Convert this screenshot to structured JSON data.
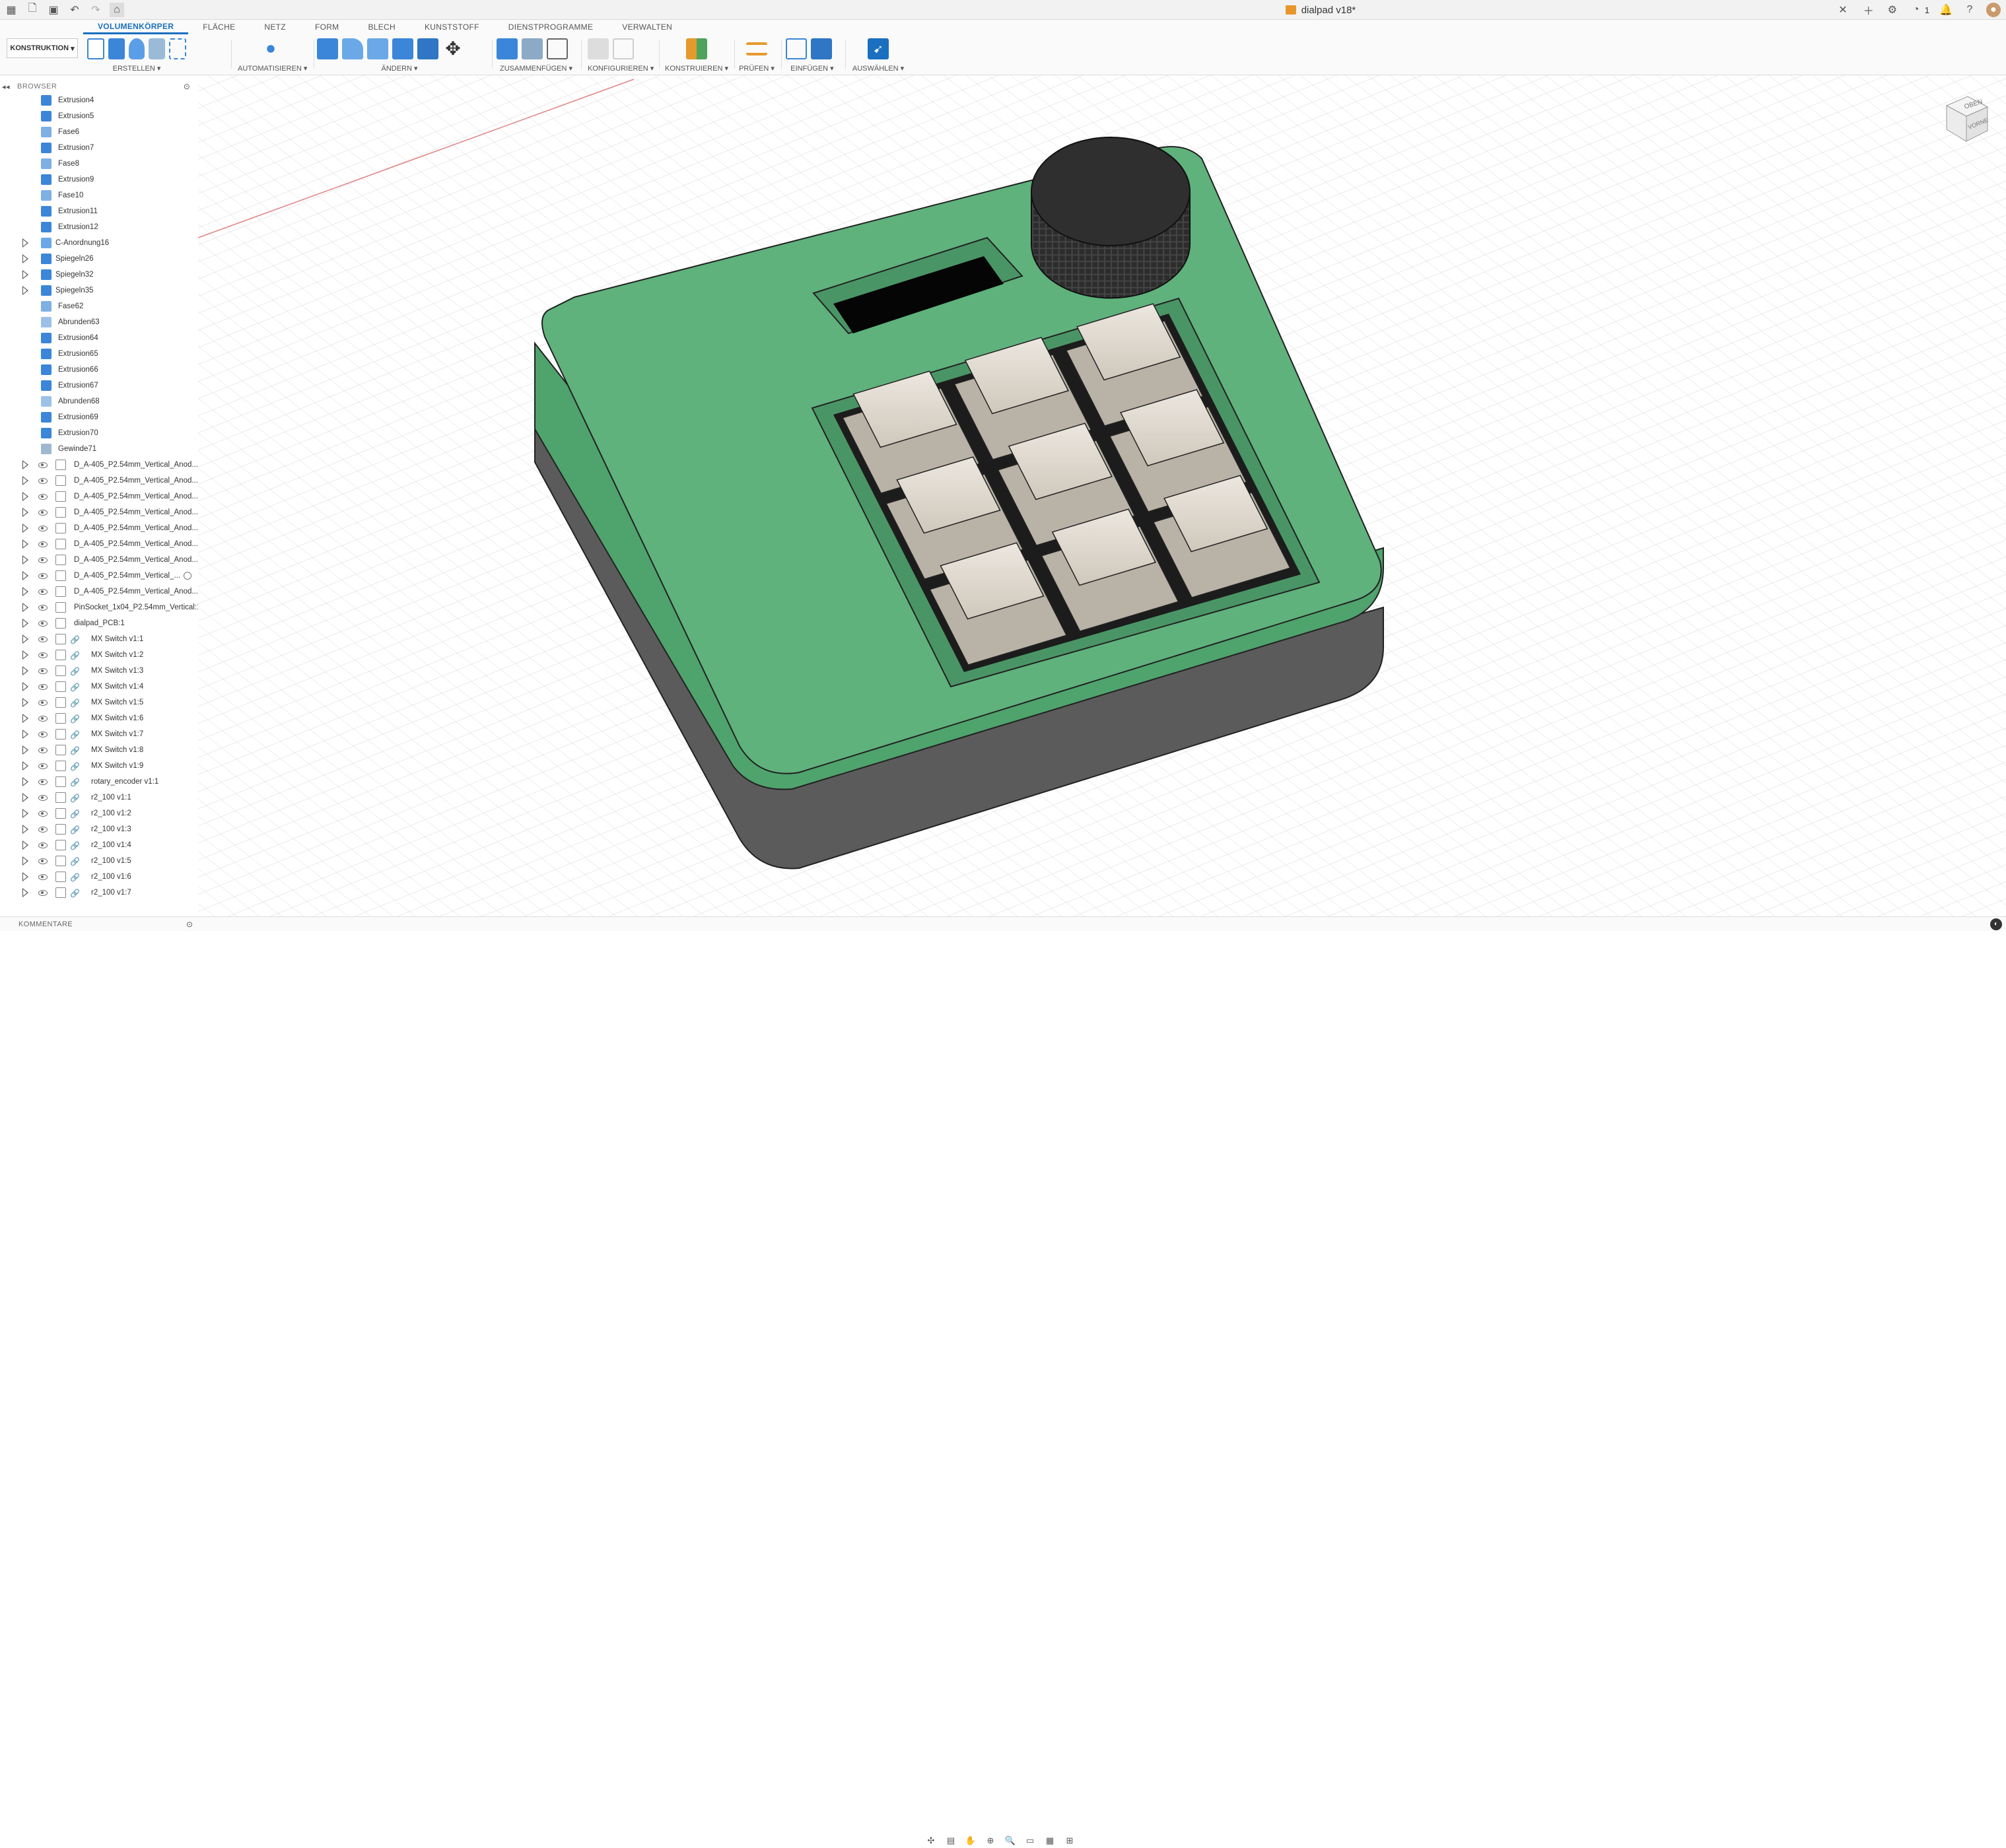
{
  "titlebar": {
    "doc_title": "dialpad v18*",
    "notif_count": "1"
  },
  "ribbon": {
    "workspace_label": "KONSTRUKTION",
    "tabs": [
      {
        "label": "VOLUMENKÖRPER",
        "active": true
      },
      {
        "label": "FLÄCHE",
        "active": false
      },
      {
        "label": "NETZ",
        "active": false
      },
      {
        "label": "FORM",
        "active": false
      },
      {
        "label": "BLECH",
        "active": false
      },
      {
        "label": "KUNSTSTOFF",
        "active": false
      },
      {
        "label": "DIENSTPROGRAMME",
        "active": false
      },
      {
        "label": "VERWALTEN",
        "active": false
      }
    ],
    "groups": {
      "erstellen": "ERSTELLEN ▾",
      "automatisieren": "AUTOMATISIEREN ▾",
      "aendern": "ÄNDERN ▾",
      "zusammenfuegen": "ZUSAMMENFÜGEN ▾",
      "konfigurieren": "KONFIGURIEREN ▾",
      "konstruieren": "KONSTRUIEREN ▾",
      "pruefen": "PRÜFEN ▾",
      "einfuegen": "EINFÜGEN ▾",
      "auswaehlen": "AUSWÄHLEN ▾"
    }
  },
  "browser": {
    "header": "BROWSER",
    "features": [
      {
        "label": "Extrusion4",
        "kind": "extrude"
      },
      {
        "label": "Extrusion5",
        "kind": "extrude"
      },
      {
        "label": "Fase6",
        "kind": "chamfer"
      },
      {
        "label": "Extrusion7",
        "kind": "extrude"
      },
      {
        "label": "Fase8",
        "kind": "chamfer"
      },
      {
        "label": "Extrusion9",
        "kind": "extrude"
      },
      {
        "label": "Fase10",
        "kind": "chamfer"
      },
      {
        "label": "Extrusion11",
        "kind": "extrude"
      },
      {
        "label": "Extrusion12",
        "kind": "extrude"
      },
      {
        "label": "C-Anordnung16",
        "kind": "pattern",
        "expandable": true
      },
      {
        "label": "Spiegeln26",
        "kind": "mirror",
        "expandable": true
      },
      {
        "label": "Spiegeln32",
        "kind": "mirror",
        "expandable": true
      },
      {
        "label": "Spiegeln35",
        "kind": "mirror",
        "expandable": true
      },
      {
        "label": "Fase62",
        "kind": "chamfer"
      },
      {
        "label": "Abrunden63",
        "kind": "fillet"
      },
      {
        "label": "Extrusion64",
        "kind": "extrude"
      },
      {
        "label": "Extrusion65",
        "kind": "extrude"
      },
      {
        "label": "Extrusion66",
        "kind": "extrude"
      },
      {
        "label": "Extrusion67",
        "kind": "extrude"
      },
      {
        "label": "Abrunden68",
        "kind": "fillet"
      },
      {
        "label": "Extrusion69",
        "kind": "extrude"
      },
      {
        "label": "Extrusion70",
        "kind": "extrude"
      },
      {
        "label": "Gewinde71",
        "kind": "thread"
      }
    ],
    "components": [
      {
        "label": "D_A-405_P2.54mm_Vertical_Anod...",
        "link": false
      },
      {
        "label": "D_A-405_P2.54mm_Vertical_Anod...",
        "link": false
      },
      {
        "label": "D_A-405_P2.54mm_Vertical_Anod...",
        "link": false
      },
      {
        "label": "D_A-405_P2.54mm_Vertical_Anod...",
        "link": false
      },
      {
        "label": "D_A-405_P2.54mm_Vertical_Anod...",
        "link": false
      },
      {
        "label": "D_A-405_P2.54mm_Vertical_Anod...",
        "link": false
      },
      {
        "label": "D_A-405_P2.54mm_Vertical_Anod...",
        "link": false
      },
      {
        "label": "D_A-405_P2.54mm_Vertical_...",
        "link": false,
        "radio": true
      },
      {
        "label": "D_A-405_P2.54mm_Vertical_Anod...",
        "link": false
      },
      {
        "label": "PinSocket_1x04_P2.54mm_Vertical:1",
        "link": false
      },
      {
        "label": "dialpad_PCB:1",
        "link": false
      },
      {
        "label": "MX Switch v1:1",
        "link": true
      },
      {
        "label": "MX Switch v1:2",
        "link": true
      },
      {
        "label": "MX Switch v1:3",
        "link": true
      },
      {
        "label": "MX Switch v1:4",
        "link": true
      },
      {
        "label": "MX Switch v1:5",
        "link": true
      },
      {
        "label": "MX Switch v1:6",
        "link": true
      },
      {
        "label": "MX Switch v1:7",
        "link": true
      },
      {
        "label": "MX Switch v1:8",
        "link": true
      },
      {
        "label": "MX Switch v1:9",
        "link": true
      },
      {
        "label": "rotary_encoder v1:1",
        "link": true
      },
      {
        "label": "r2_100 v1:1",
        "link": true
      },
      {
        "label": "r2_100 v1:2",
        "link": true
      },
      {
        "label": "r2_100 v1:3",
        "link": true
      },
      {
        "label": "r2_100 v1:4",
        "link": true
      },
      {
        "label": "r2_100 v1:5",
        "link": true
      },
      {
        "label": "r2_100 v1:6",
        "link": true
      },
      {
        "label": "r2_100 v1:7",
        "link": true
      }
    ]
  },
  "comments_label": "KOMMENTARE",
  "viewcube": {
    "top": "OBEN",
    "front": "VORNE"
  },
  "colors": {
    "case_green": "#5fb27c",
    "case_dark": "#5b5b5b",
    "knob": "#2f2f2f",
    "keycap": "#e4ded5",
    "accent": "#1a6fc0"
  }
}
